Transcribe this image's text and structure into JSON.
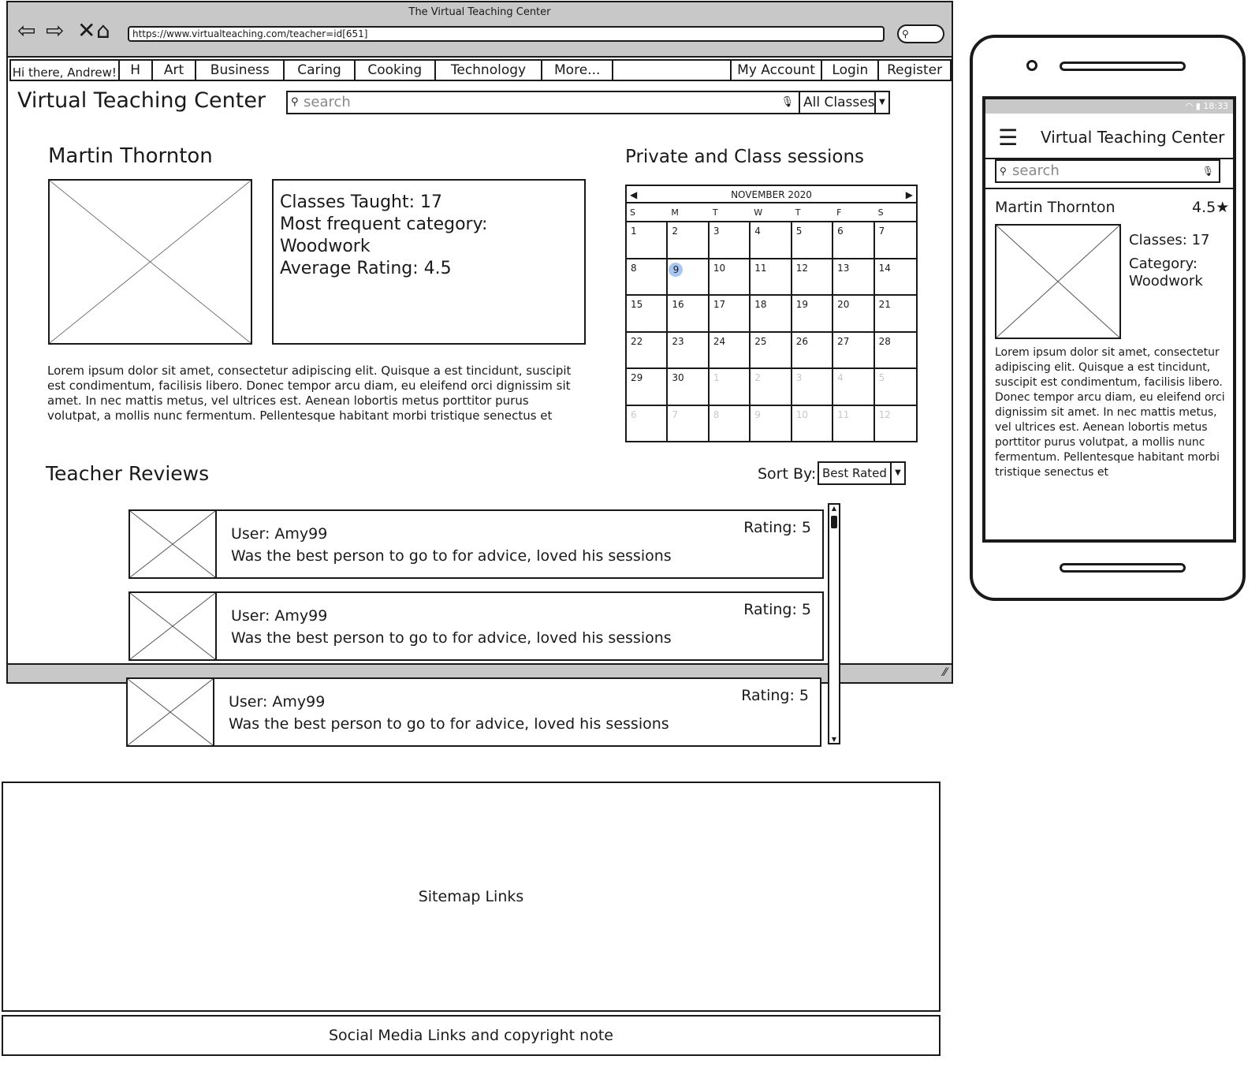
{
  "browser": {
    "title": "The Virtual Teaching Center",
    "url": "https://www.virtualteaching.com/teacher=id[651]"
  },
  "menubar": {
    "greeting": "Hi there, Andrew!",
    "items": [
      "H",
      "Art",
      "Business",
      "Caring",
      "Cooking",
      "Technology",
      "More..."
    ],
    "right_items": [
      "My Account",
      "Login",
      "Register"
    ]
  },
  "site": {
    "title": "Virtual Teaching Center",
    "search_placeholder": "search",
    "class_filter": "All Classes"
  },
  "teacher": {
    "name": "Martin Thornton",
    "stats": [
      "Classes Taught: 17",
      "Most frequent category: Woodwork",
      "Average Rating: 4.5"
    ],
    "bio": "Lorem ipsum dolor sit amet, consectetur adipiscing elit. Quisque a est tincidunt, suscipit est condimentum, facilisis libero. Donec tempor arcu diam, eu eleifend orci dignissim sit amet. In nec mattis metus, vel ultrices est. Aenean lobortis metus porttitor purus volutpat, a mollis nunc fermentum. Pellentesque habitant morbi tristique senectus et"
  },
  "sessions": {
    "heading": "Private and Class sessions",
    "month": "NOVEMBER 2020",
    "weekdays": [
      "S",
      "M",
      "T",
      "W",
      "T",
      "F",
      "S"
    ],
    "weeks": [
      [
        "1",
        "2",
        "3",
        "4",
        "5",
        "6",
        "7"
      ],
      [
        "8",
        "9",
        "10",
        "11",
        "12",
        "13",
        "14"
      ],
      [
        "15",
        "16",
        "17",
        "18",
        "19",
        "20",
        "21"
      ],
      [
        "22",
        "23",
        "24",
        "25",
        "26",
        "27",
        "28"
      ],
      [
        "29",
        "30",
        "1",
        "2",
        "3",
        "4",
        "5"
      ],
      [
        "6",
        "7",
        "8",
        "9",
        "10",
        "11",
        "12"
      ]
    ],
    "selected_day": "9"
  },
  "reviews": {
    "heading": "Teacher Reviews",
    "sort_label": "Sort By:",
    "sort_value": "Best Rated",
    "items": [
      {
        "user": "User: Amy99",
        "text": "Was the best person to go to for advice, loved his sessions",
        "rating": "Rating: 5"
      },
      {
        "user": "User: Amy99",
        "text": "Was the best person to go to for advice, loved his sessions",
        "rating": "Rating: 5"
      },
      {
        "user": "User: Amy99",
        "text": "Was the best person to go to for advice, loved his sessions",
        "rating": "Rating: 5"
      }
    ]
  },
  "footer": {
    "sitemap": "Sitemap Links",
    "social": "Social Media Links and copyright note"
  },
  "mobile": {
    "status_time": "18:33",
    "title": "Virtual Teaching Center",
    "search_placeholder": "search",
    "teacher_name": "Martin Thornton",
    "rating": "4.5",
    "classes": "Classes: 17",
    "category_label": "Category:",
    "category_value": "Woodwork",
    "bio": "Lorem ipsum dolor sit amet, consectetur adipiscing elit. Quisque a est tincidunt, suscipit est condimentum, facilisis libero. Donec tempor arcu diam, eu eleifend orci dignissim sit amet. In nec mattis metus, vel ultrices est. Aenean lobortis metus porttitor purus volutpat, a mollis nunc fermentum. Pellentesque habitant morbi tristique senectus et"
  },
  "colors": {
    "chrome_gray": "#c8c8c8",
    "ink": "#1a1a1a",
    "selected_day": "#a9c6f0"
  }
}
